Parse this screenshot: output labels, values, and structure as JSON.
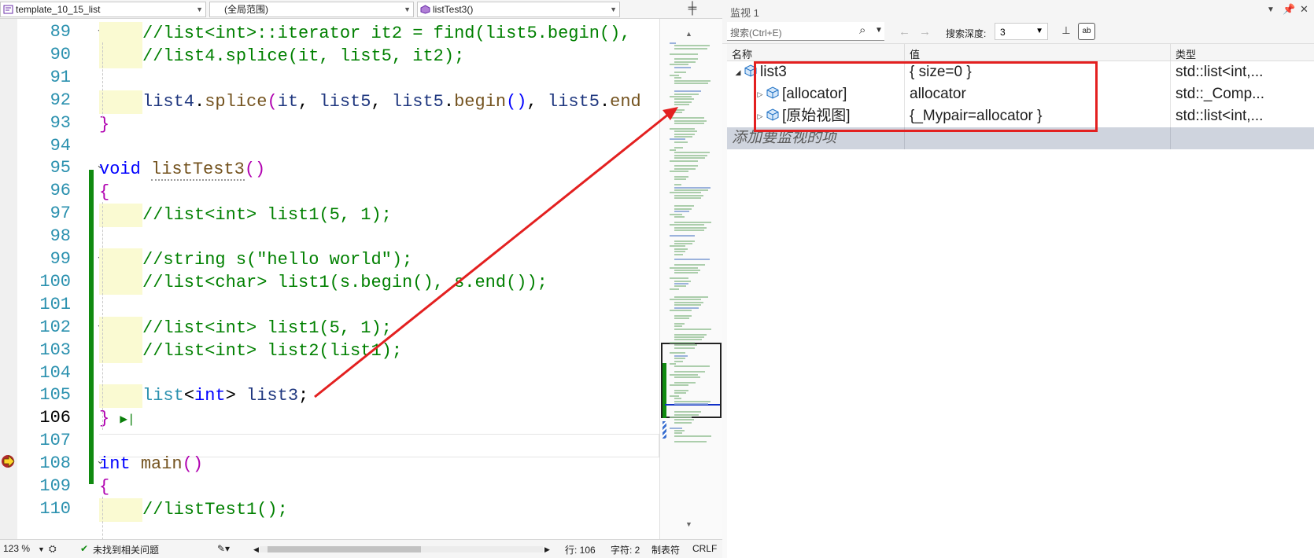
{
  "editor": {
    "nav": {
      "file": "template_10_15_list",
      "scope": "(全局范围)",
      "member": "listTest3()"
    },
    "lines": [
      {
        "num": "89",
        "fold": "⌄"
      },
      {
        "num": "90",
        "fold": ""
      },
      {
        "num": "91",
        "fold": ""
      },
      {
        "num": "92",
        "fold": ""
      },
      {
        "num": "93",
        "fold": ""
      },
      {
        "num": "94",
        "fold": ""
      },
      {
        "num": "95",
        "fold": "⌄"
      },
      {
        "num": "96",
        "fold": ""
      },
      {
        "num": "97",
        "fold": ""
      },
      {
        "num": "98",
        "fold": ""
      },
      {
        "num": "99",
        "fold": "⌄"
      },
      {
        "num": "100",
        "fold": ""
      },
      {
        "num": "101",
        "fold": ""
      },
      {
        "num": "102",
        "fold": "⌄"
      },
      {
        "num": "103",
        "fold": ""
      },
      {
        "num": "104",
        "fold": ""
      },
      {
        "num": "105",
        "fold": ""
      },
      {
        "num": "106",
        "fold": ""
      },
      {
        "num": "107",
        "fold": ""
      },
      {
        "num": "108",
        "fold": "⌄"
      },
      {
        "num": "109",
        "fold": ""
      },
      {
        "num": "110",
        "fold": ""
      }
    ],
    "code": {
      "l89": "//list<int>::iterator it2 = find(list5.begin(),",
      "l90": "//list4.splice(it, list5, it2);",
      "l97": "//list<int> list1(5, 1);",
      "l99": "//string s(\"hello world\");",
      "l100": "//list<char> list1(s.begin(), s.end());",
      "l102": "//list<int> list1(5, 1);",
      "l103": "//list<int> list2(list1);",
      "l110": "//listTest1();",
      "kw_void": "void",
      "kw_int": "int",
      "fn_listTest3": "listTest3",
      "fn_main": "main",
      "fn_splice": "splice",
      "fn_begin": "begin",
      "fn_end": "end",
      "id_list4": "list4",
      "id_it": "it",
      "id_list5": "list5",
      "id_list3": "list3",
      "ty_list": "list",
      "ty_int": "int",
      "open_paren": "(",
      "close_paren": ")",
      "empty_parens": "()",
      "open_brace": "{",
      "close_brace": "}",
      "comma_sp": ", ",
      "dot": ".",
      "semicolon": ";",
      "lt": "<",
      "gt_sp": "> "
    },
    "status": {
      "zoom": "123 %",
      "issues": "未找到相关问题",
      "line": "行: 106",
      "char": "字符: 2",
      "tabs": "制表符",
      "eol": "CRLF"
    }
  },
  "watch": {
    "title": "监视 1",
    "search_placeholder": "搜索(Ctrl+E)",
    "depth_label": "搜索深度:",
    "depth_value": "3",
    "columns": {
      "name": "名称",
      "value": "值",
      "type": "类型"
    },
    "rows": [
      {
        "name": "list3",
        "value": "{ size=0 }",
        "type": "std::list<int,...",
        "expander": "◢"
      },
      {
        "name": "[allocator]",
        "value": "allocator",
        "type": "std::_Comp...",
        "expander": "▷"
      },
      {
        "name": "[原始视图]",
        "value": "{_Mypair=allocator }",
        "type": "std::list<int,...",
        "expander": "▷"
      }
    ],
    "add_placeholder": "添加要监视的项"
  },
  "colors": {
    "annotation": "#e32020",
    "change_bar": "#108a10",
    "keyword": "#0000ff",
    "comment": "#008000"
  }
}
